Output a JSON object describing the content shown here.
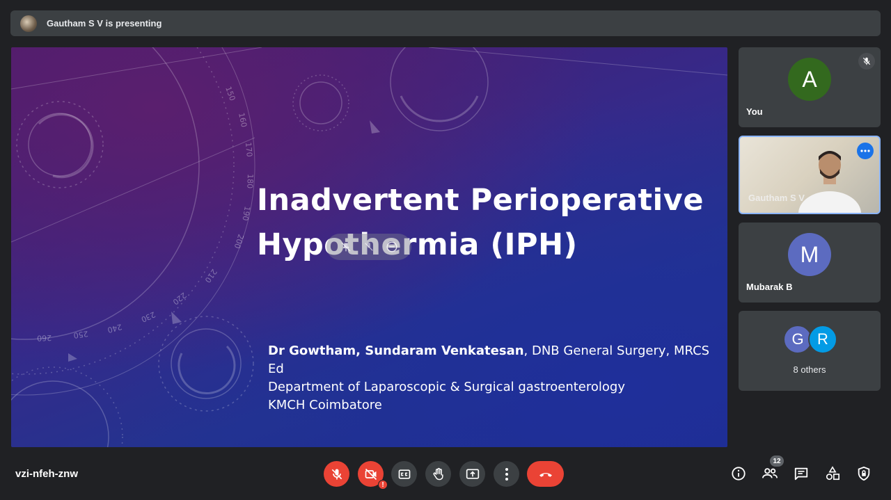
{
  "presenting": {
    "text": "Gautham S V is presenting"
  },
  "slide": {
    "title_line1": "Inadvertent Perioperative",
    "title_line2": "Hypothermia (IPH)",
    "author_bold": "Dr Gowtham, Sundaram Venkatesan",
    "author_rest": ", DNB General Surgery, MRCS Ed",
    "department": "Department of Laparoscopic & Surgical gastroenterology",
    "institution": "KMCH  Coimbatore",
    "dial_numbers": [
      "150",
      "160",
      "170",
      "180",
      "190",
      "200",
      "210",
      "220",
      "230",
      "240",
      "250",
      "260"
    ]
  },
  "participants": {
    "you": {
      "initial": "A",
      "name": "You",
      "color": "#33691e"
    },
    "gautham": {
      "name": "Gautham S V"
    },
    "mubarak": {
      "initial": "M",
      "name": "Mubarak B",
      "color": "#5c6bc0"
    },
    "others": {
      "initial1": "G",
      "initial2": "R",
      "label": "8 others"
    }
  },
  "bottom_bar": {
    "meeting_code": "vzi-nfeh-znw",
    "people_count": "12",
    "error_mark": "!"
  },
  "colors": {
    "accent": "#8ab4f8",
    "danger": "#ea4335",
    "control_grey": "#3c4043",
    "background": "#202124"
  }
}
